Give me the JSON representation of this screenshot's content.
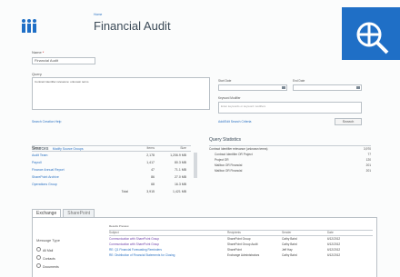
{
  "header": {
    "breadcrumb": "Home",
    "title": "Financial Audit",
    "brand_color": "#1f6fc6",
    "logo_icon": "people-org-icon",
    "zoom_icon": "zoom-crosshair-icon"
  },
  "form": {
    "name_label": "Name",
    "required_mark": "*",
    "name_value": "Financial Audit",
    "query_label": "Query",
    "query_value": "Contract Identifier relevance: unknown terms",
    "start_label": "Start Date",
    "end_label": "End Date",
    "keyword_label": "Keyword Modifier",
    "keyword_placeholder": "Enter keywords or keyword modifiers",
    "left_link": "Search Creation Help",
    "right_link": "Add/Edit Search Criteria",
    "button_label": "Search"
  },
  "sources": {
    "title": "Sources",
    "link": "Modify Source Groups",
    "columns": [
      "Name",
      "Items",
      "Size"
    ],
    "rows": [
      {
        "name": "Audit Team",
        "items": "2,178",
        "size": "1,206.9 MB"
      },
      {
        "name": "Payroll",
        "items": "1,417",
        "size": "80.3 MB"
      },
      {
        "name": "Finance Annual Report",
        "items": "47",
        "size": "71.1 MB"
      },
      {
        "name": "SharePoint Archive",
        "items": "86",
        "size": "27.0 MB"
      },
      {
        "name": "Operations Group",
        "items": "68",
        "size": "16.3 MB"
      }
    ],
    "total_label": "Total",
    "total_items": "3,915",
    "total_size": "1,421 MB"
  },
  "stats": {
    "title": "Query Statistics",
    "rows": [
      {
        "label": "Contract Identifier relevance (unknown terms)",
        "value": "3,970"
      },
      {
        "label": "Contract Identifier OR Project",
        "value": "77"
      },
      {
        "label": "Project OR",
        "value": "120"
      },
      {
        "label": "Mailbox OR Financial",
        "value": "201"
      },
      {
        "label": "Mailbox OR Financial",
        "value": "201"
      }
    ]
  },
  "tabs": [
    "Exchange",
    "SharePoint"
  ],
  "filter": {
    "title": "Message Type",
    "options": [
      "All Mail",
      "Contacts",
      "Documents"
    ]
  },
  "results": {
    "summary": "Results Preview",
    "columns": [
      "Subject",
      "Recipients",
      "Sender",
      "Date"
    ],
    "rows": [
      {
        "subject": "Communication with SharePoint Group",
        "recipients": "SharePoint Group",
        "sender": "Cathy Baird",
        "date": "6/12/2012"
      },
      {
        "subject": "Communication with SharePoint Group",
        "recipients": "SharePoint Group Audit",
        "sender": "Cathy Baird",
        "date": "6/12/2012"
      },
      {
        "subject": "RE: Q1 Financial Forecasting Reminders",
        "recipients": "SharePoint",
        "sender": "Jeff Hay",
        "date": "6/12/2012"
      },
      {
        "subject": "RE: Distribution of Financial Statements for Closing",
        "recipients": "Exchange Administrators",
        "sender": "Cathy Baird",
        "date": "6/12/2012"
      }
    ]
  }
}
